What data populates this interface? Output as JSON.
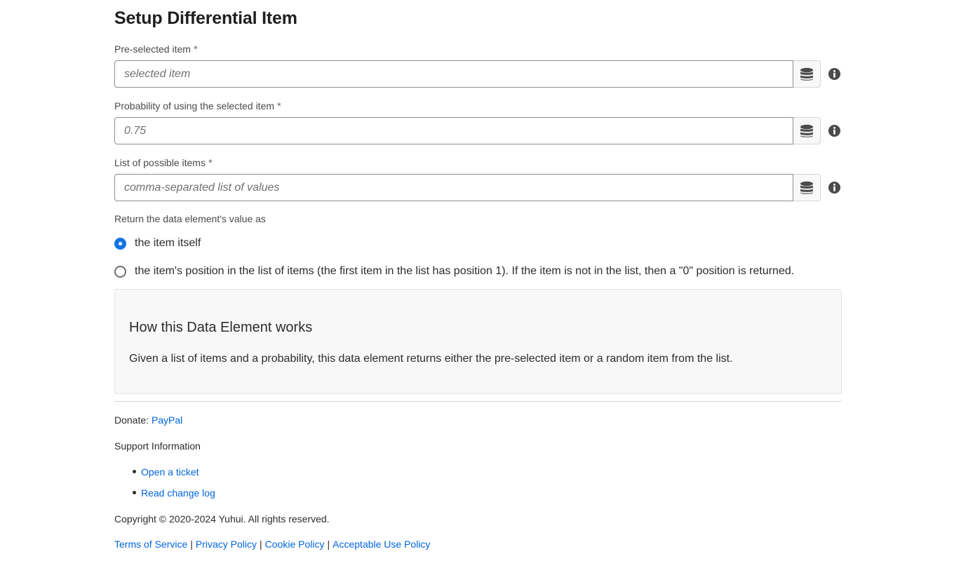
{
  "page": {
    "title": "Setup Differential Item"
  },
  "fields": [
    {
      "label": "Pre-selected item",
      "required_mark": "*",
      "value": "",
      "placeholder": "selected item",
      "data_icon": "database-icon",
      "info_icon": "info-icon"
    },
    {
      "label": "Probability of using the selected item",
      "required_mark": "*",
      "value": "",
      "placeholder": "0.75",
      "data_icon": "database-icon",
      "info_icon": "info-icon"
    },
    {
      "label": "List of possible items",
      "required_mark": "*",
      "value": "",
      "placeholder": "comma-separated list of values",
      "data_icon": "database-icon",
      "info_icon": "info-icon"
    }
  ],
  "return_as": {
    "label": "Return the data element's value as",
    "options": [
      {
        "label": "the item itself",
        "selected": true
      },
      {
        "label": "the item's position in the list of items (the first item in the list has position 1). If the item is not in the list, then a \"0\" position is returned.",
        "selected": false
      }
    ]
  },
  "howto": {
    "title": "How this Data Element works",
    "text": "Given a list of items and a probability, this data element returns either the pre-selected item or a random item from the list."
  },
  "footer": {
    "donate_label": "Donate:",
    "donate_link": "PayPal",
    "support_label": "Support Information",
    "support_links": [
      "Open a ticket",
      "Read change log"
    ],
    "copyright": "Copyright © 2020-2024 Yuhui. All rights reserved.",
    "legal_links": [
      "Terms of Service",
      "Privacy Policy",
      "Cookie Policy",
      "Acceptable Use Policy"
    ],
    "separator": "|"
  },
  "colors": {
    "accent": "#1473e6",
    "link": "#0265dc",
    "panel_bg": "#f8f8f8"
  }
}
